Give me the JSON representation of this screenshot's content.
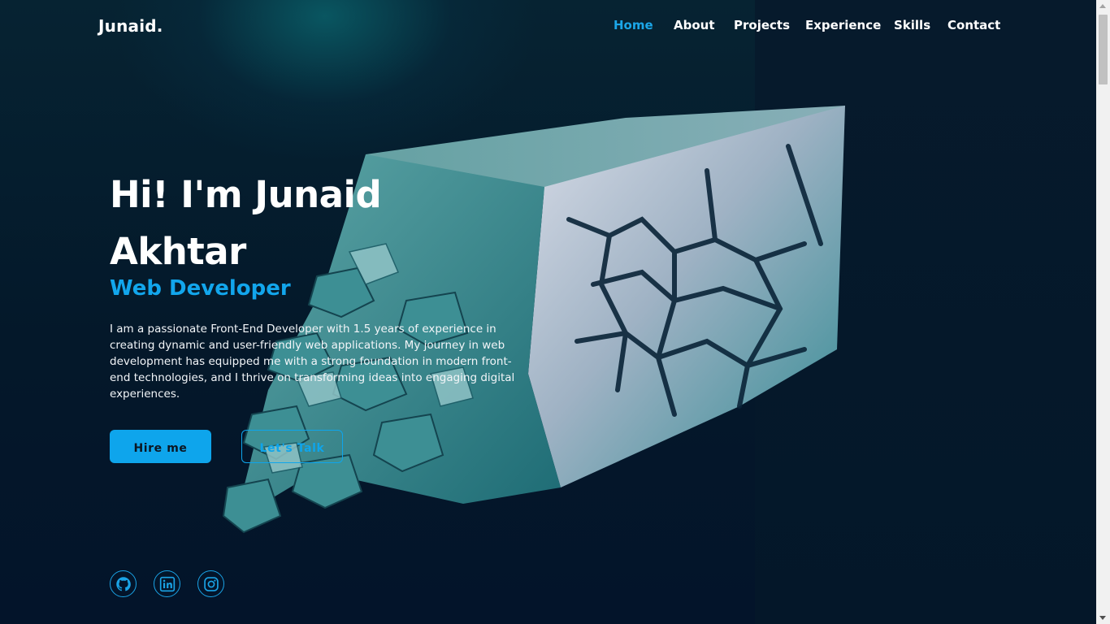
{
  "header": {
    "logo": "Junaid.",
    "nav": [
      {
        "label": "Home",
        "active": true
      },
      {
        "label": "About",
        "active": false
      },
      {
        "label": "Projects",
        "active": false
      },
      {
        "label": "Experience",
        "active": false
      },
      {
        "label": "Skills",
        "active": false
      },
      {
        "label": "Contact",
        "active": false
      }
    ]
  },
  "hero": {
    "greeting": "Hi! I'm Junaid Akhtar",
    "role": "Web Developer",
    "description": "I am a passionate Front-End Developer with 1.5 years of experience in creating dynamic and user-friendly web applications. My journey in web development has equipped me with a strong foundation in modern front-end technologies, and I thrive on transforming ideas into engaging digital experiences.",
    "primary_button": "Hire me",
    "secondary_button": "Let's Talk"
  },
  "social": [
    {
      "icon": "github-icon"
    },
    {
      "icon": "linkedin-icon"
    },
    {
      "icon": "instagram-icon"
    }
  ],
  "colors": {
    "accent": "#0ea5ec",
    "background": "#041322",
    "text": "#ffffff"
  }
}
